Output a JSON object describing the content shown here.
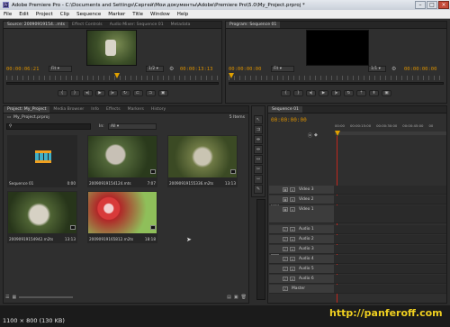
{
  "window": {
    "title": "Adobe Premiere Pro - C:\\Documents and Settings\\Сергей\\Мои документы\\Adobe\\Premiere Pro\\5.0\\My_Project.prproj *"
  },
  "menu": [
    "File",
    "Edit",
    "Project",
    "Clip",
    "Sequence",
    "Marker",
    "Title",
    "Window",
    "Help"
  ],
  "source": {
    "tabs": [
      "Source: 20090919154...mts",
      "Effect Controls",
      "Audio Mixer: Sequence 01",
      "Metadata"
    ],
    "timecode_left": "00:00:06:21",
    "fit": "Fit",
    "ratio": "1/2",
    "timecode_right": "00:00:13:13"
  },
  "program": {
    "tabs": [
      "Program: Sequence 01"
    ],
    "timecode_left": "00:00:00:00",
    "fit": "Fit",
    "ratio": "1/1",
    "timecode_right": "00:00:00:00"
  },
  "project": {
    "tabs": [
      "Project: My_Project",
      "Media Browser",
      "Info",
      "Effects",
      "Markers",
      "History"
    ],
    "file": "My_Project.prproj",
    "items_count": "5 Items",
    "in_label": "In:",
    "in_value": "All",
    "items": [
      {
        "name": "Sequence 01",
        "duration": "0:00"
      },
      {
        "name": "20090919154124.mts",
        "duration": "7:07"
      },
      {
        "name": "20090919155336.m2ts",
        "duration": "13:13"
      },
      {
        "name": "20090919154942.m2ts",
        "duration": "13:13"
      },
      {
        "name": "20090919165812.m2ts",
        "duration": "18:18"
      }
    ]
  },
  "timeline": {
    "tabs": [
      "Sequence 01"
    ],
    "timecode": "00:00:00:00",
    "ruler": [
      "00:00",
      "00:00:15:00",
      "00:00:30:00",
      "00:00:45:00",
      "00"
    ],
    "v_label": "V",
    "a_label": "A1",
    "tracks": [
      "Video 3",
      "Video 2",
      "Video 1",
      "Audio 1",
      "Audio 2",
      "Audio 3",
      "Audio 4",
      "Audio 5",
      "Audio 6",
      "Master"
    ]
  },
  "status": {
    "watermark": "http://panferoff.com",
    "size_label": "1100 × 800 (130 KB)"
  },
  "colors": {
    "accent": "#d99000",
    "playhead": "#c0261c",
    "watermark": "#f0d020"
  }
}
